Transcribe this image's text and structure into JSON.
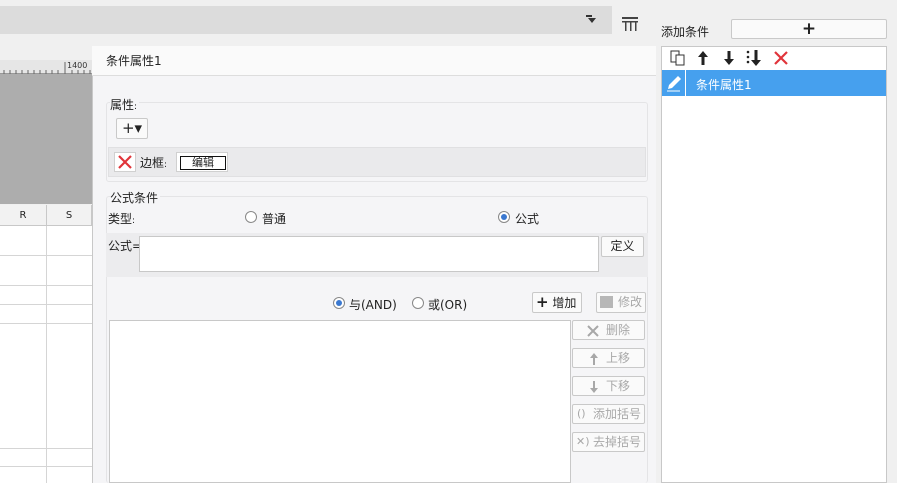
{
  "toolbar": {
    "collapse_icon": "collapse-arrow-icon",
    "layout_icon": "layout-panel-icon"
  },
  "sheet": {
    "ruler_value": "1400",
    "columns": [
      "R",
      "S"
    ]
  },
  "dialog": {
    "title": "条件属性1",
    "attributes": {
      "group_label": "属性",
      "add_label": "+▾",
      "item_label": "边框",
      "edit_button": "编辑"
    },
    "formula_condition": {
      "group_label": "公式条件",
      "type_label": "类型",
      "option_normal": "普通",
      "option_formula": "公式",
      "selected": "公式",
      "formula_label": "公式=",
      "formula_value": "",
      "define_button": "定义",
      "logic_and": "与(AND)",
      "logic_or": "或(OR)",
      "logic_selected": "与(AND)",
      "add_button": "增加",
      "modify_button": "修改",
      "delete_button": "删除",
      "move_up_button": "上移",
      "move_down_button": "下移",
      "add_bracket_button": "添加括号",
      "remove_bracket_button": "去掉括号"
    }
  },
  "right_panel": {
    "add_condition_label": "添加条件",
    "add_button": "+",
    "conditions": [
      "条件属性1"
    ],
    "selected_index": 0,
    "accent_color": "#46a0ee"
  }
}
